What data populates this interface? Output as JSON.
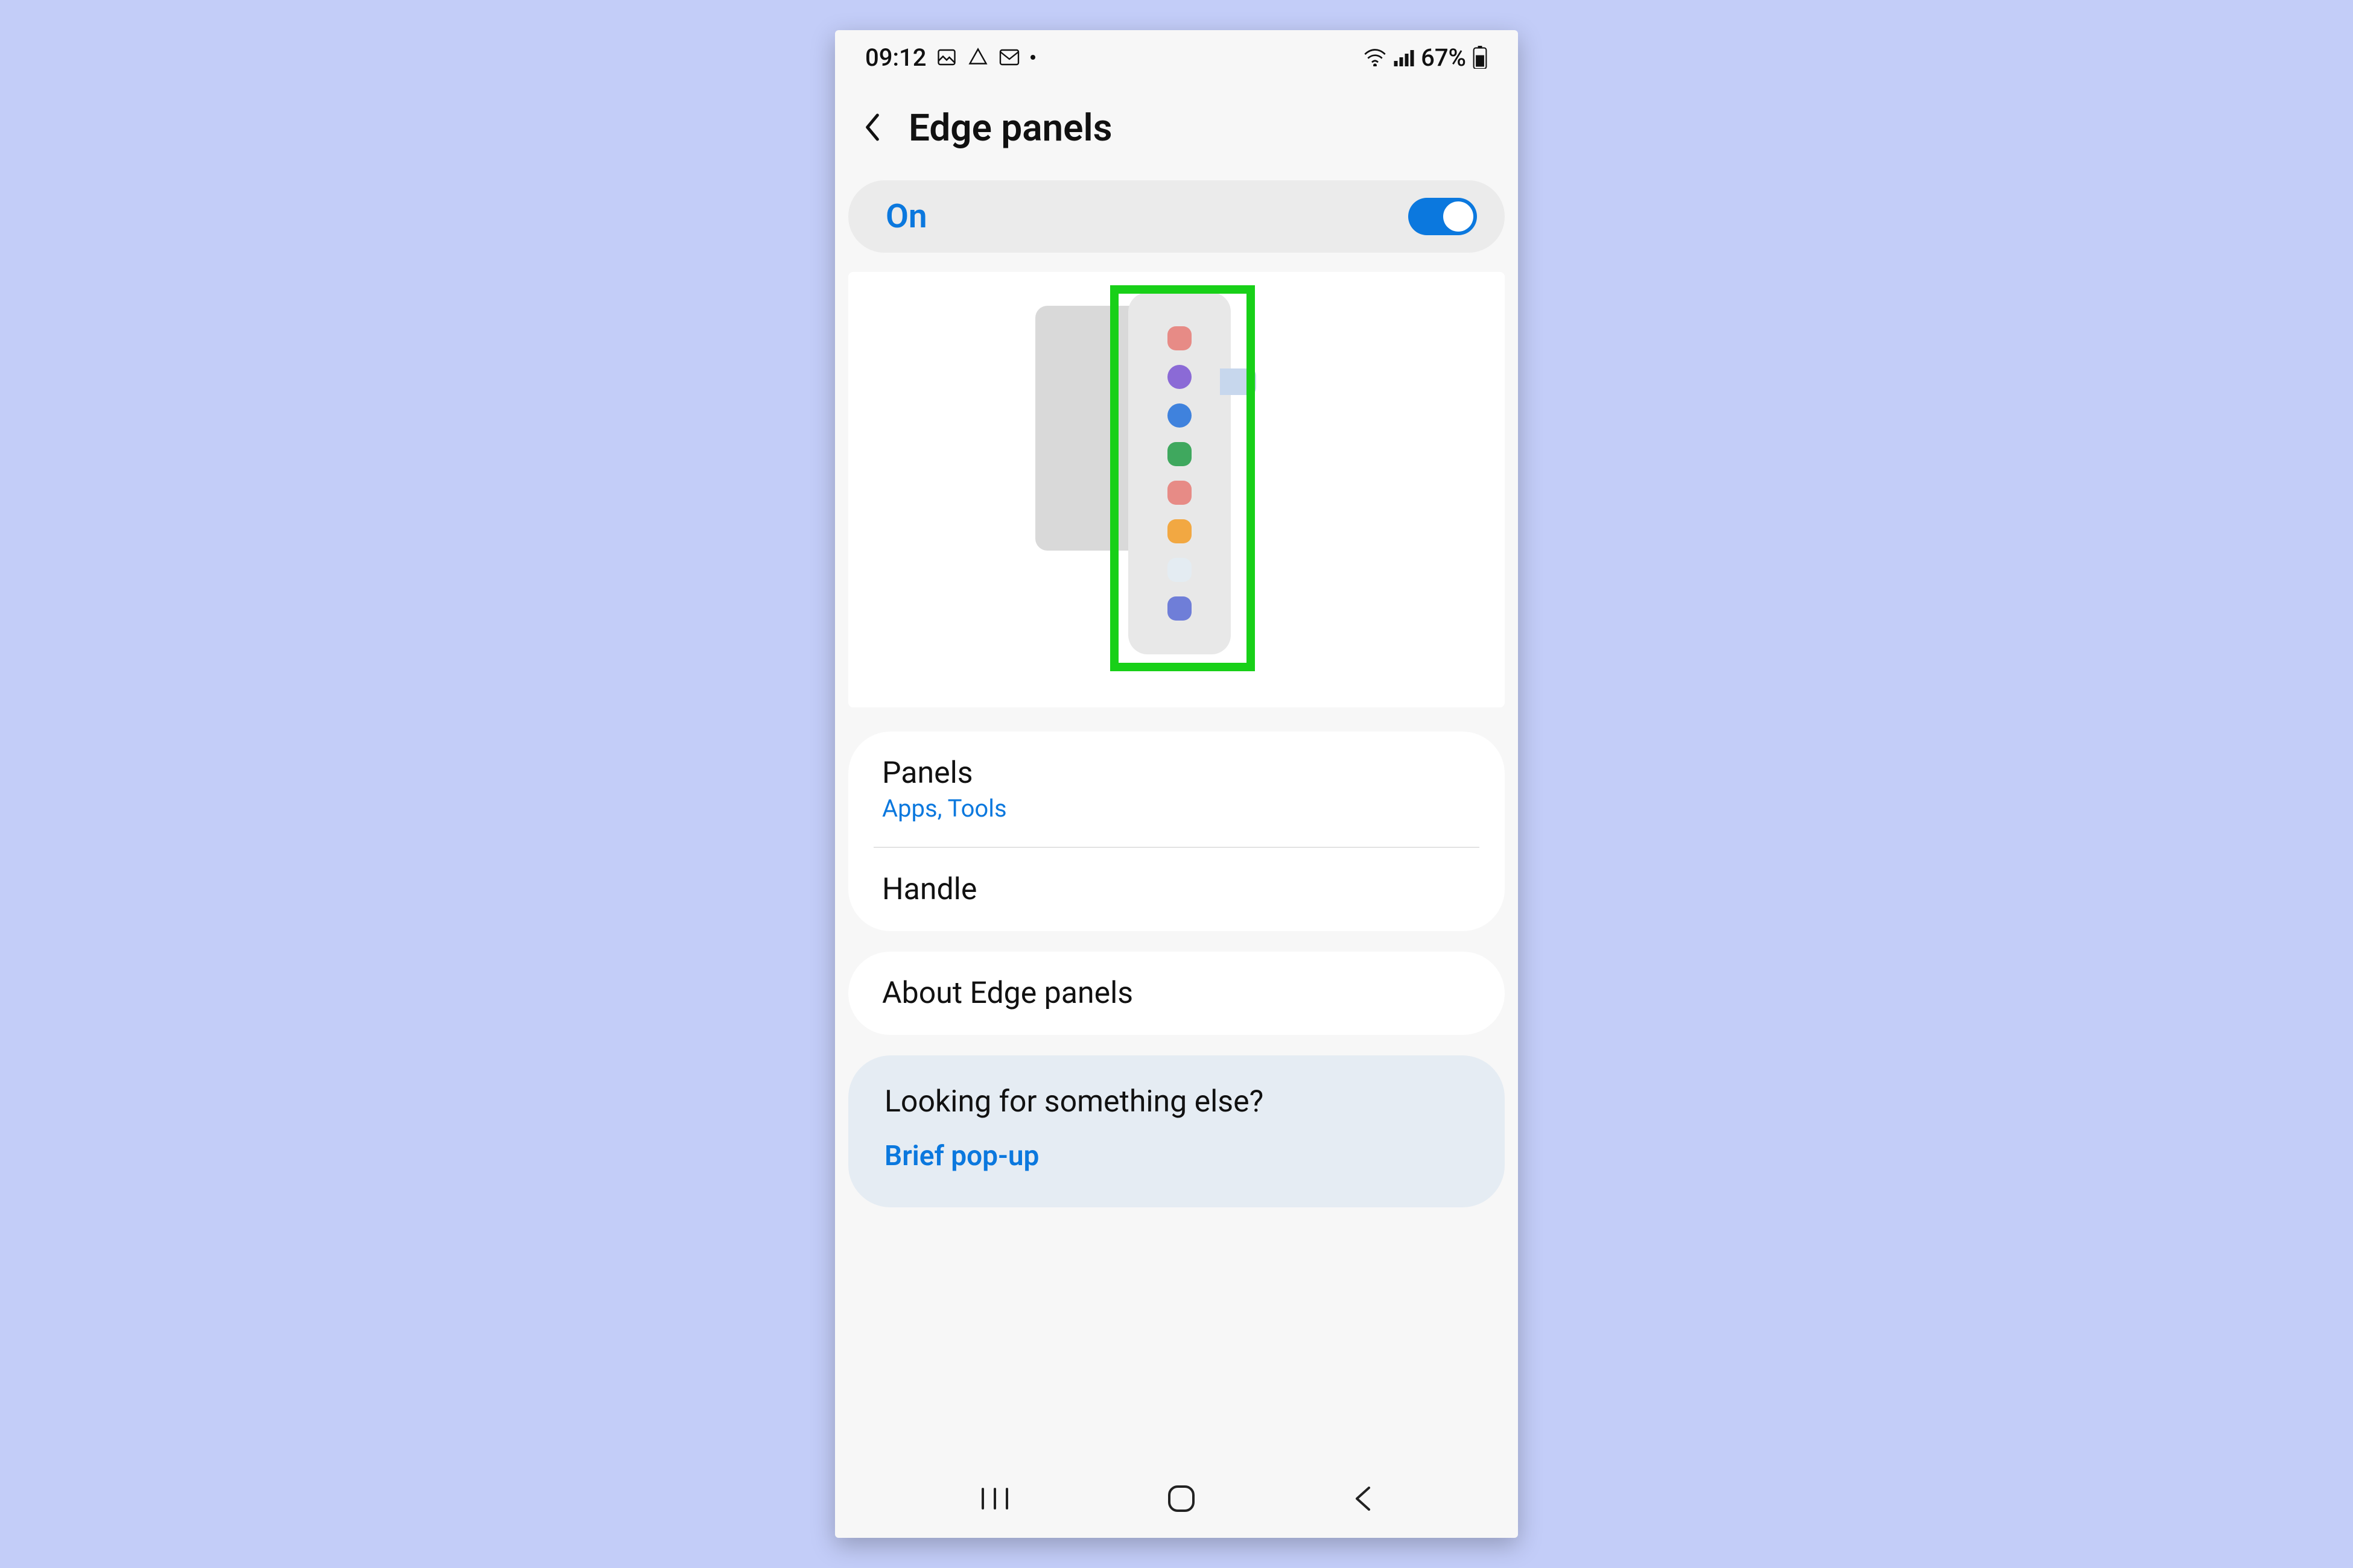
{
  "status": {
    "time": "09:12",
    "battery_text": "67%"
  },
  "header": {
    "title": "Edge panels"
  },
  "toggle": {
    "label": "On",
    "enabled": true
  },
  "preview": {
    "panel_dots": [
      {
        "color": "#e78b86",
        "shape": "rounded"
      },
      {
        "color": "#8b6ad6",
        "shape": "round"
      },
      {
        "color": "#3f82dd",
        "shape": "round"
      },
      {
        "color": "#3fa85e",
        "shape": "rounded"
      },
      {
        "color": "#e78b86",
        "shape": "rounded"
      },
      {
        "color": "#f2a842",
        "shape": "rounded"
      },
      {
        "color": "#e4ecf2",
        "shape": "rounded"
      },
      {
        "color": "#6f7ed8",
        "shape": "rounded"
      }
    ]
  },
  "rows": {
    "panels": {
      "title": "Panels",
      "subtitle": "Apps, Tools"
    },
    "handle": {
      "title": "Handle"
    },
    "about": {
      "title": "About Edge panels"
    }
  },
  "suggestions": {
    "title": "Looking for something else?",
    "link": "Brief pop-up"
  }
}
